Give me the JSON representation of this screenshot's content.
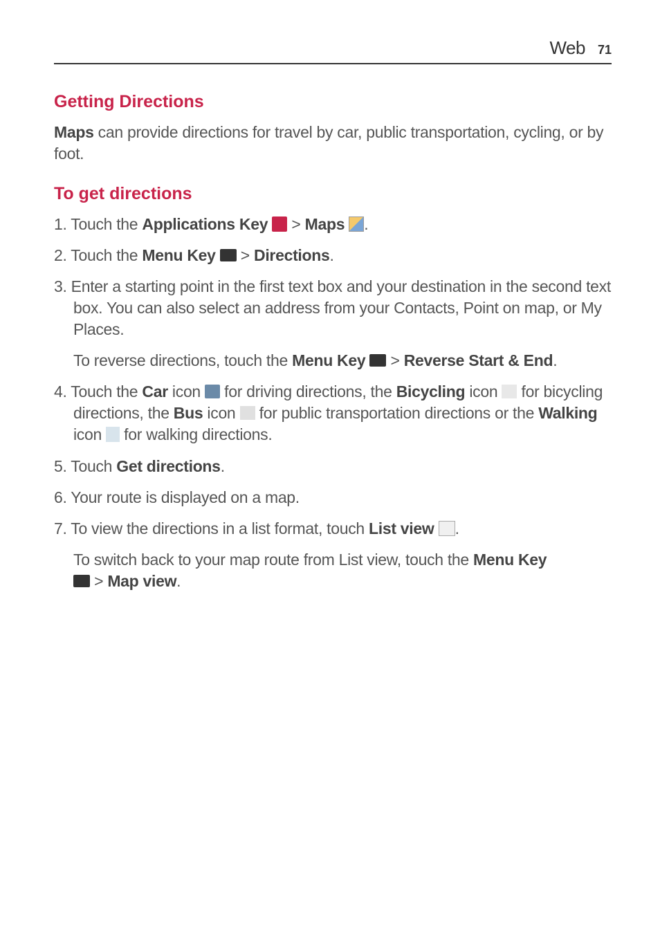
{
  "header": {
    "title": "Web",
    "page_number": "71"
  },
  "section1": {
    "heading": "Getting Directions",
    "intro_bold": "Maps",
    "intro_rest": " can provide directions for travel by car, public transportation, cycling, or by foot."
  },
  "section2": {
    "heading": "To get directions",
    "step1_prefix": "1.  Touch the ",
    "step1_bold1": "Applications Key ",
    "step1_mid": " > ",
    "step1_bold2": "Maps ",
    "step1_end": ".",
    "step2_prefix": "2. Touch the ",
    "step2_bold1": "Menu Key ",
    "step2_mid": " > ",
    "step2_bold2": "Directions",
    "step2_end": ".",
    "step3": "3. Enter a starting point in the first text box and your destination in the second text box. You can also select an address from your Contacts, Point on map, or My Places.",
    "step3_sub_prefix": " To reverse directions, touch the ",
    "step3_sub_bold1": "Menu Key ",
    "step3_sub_mid": " > ",
    "step3_sub_bold2": "Reverse Start & End",
    "step3_sub_end": ".",
    "step4_prefix": "4. Touch the ",
    "step4_bold1": "Car",
    "step4_text1": " icon ",
    "step4_text2": " for driving directions, the ",
    "step4_bold2": "Bicycling",
    "step4_text3": " icon ",
    "step4_text4": " for bicycling directions, the ",
    "step4_bold3": "Bus",
    "step4_text5": " icon ",
    "step4_text6": " for public transportation directions or the ",
    "step4_bold4": "Walking",
    "step4_text7": " icon ",
    "step4_text8": " for walking directions.",
    "step5_prefix": "5.  Touch ",
    "step5_bold": "Get directions",
    "step5_end": ".",
    "step6": "6.  Your route is displayed on a map.",
    "step7_prefix": "7.  To view the directions in a list format, touch ",
    "step7_bold": "List view ",
    "step7_end": ".",
    "step7_sub_prefix": " To switch back to your map route from List view, touch the ",
    "step7_sub_bold1": "Menu Key ",
    "step7_sub_mid": " > ",
    "step7_sub_bold2": "Map view",
    "step7_sub_end": "."
  }
}
